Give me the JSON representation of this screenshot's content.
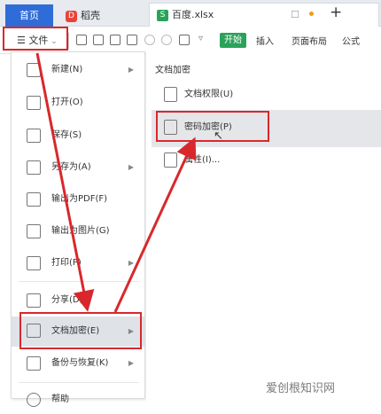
{
  "tabs": {
    "home": "首页",
    "daoke": "稻壳",
    "file": "百度.xlsx"
  },
  "toolbar": {
    "file_menu": "文件",
    "start": "开始",
    "insert": "插入",
    "page_layout": "页面布局",
    "formula": "公式"
  },
  "menu": {
    "items": [
      {
        "label": "新建(N)",
        "has_submenu": true
      },
      {
        "label": "打开(O)",
        "has_submenu": false
      },
      {
        "label": "保存(S)",
        "has_submenu": false
      },
      {
        "label": "另存为(A)",
        "has_submenu": true
      },
      {
        "label": "输出为PDF(F)",
        "has_submenu": false
      },
      {
        "label": "输出为图片(G)",
        "has_submenu": false
      },
      {
        "label": "打印(P)",
        "has_submenu": true
      },
      {
        "label": "分享(D)",
        "has_submenu": false
      },
      {
        "label": "文档加密(E)",
        "has_submenu": true,
        "active": true
      },
      {
        "label": "备份与恢复(K)",
        "has_submenu": true
      },
      {
        "label": "帮助",
        "has_submenu": true
      }
    ]
  },
  "submenu": {
    "title": "文档加密",
    "items": [
      {
        "label": "文档权限(U)"
      },
      {
        "label": "密码加密(P)",
        "active": true
      },
      {
        "label": "属性(I)..."
      }
    ]
  },
  "watermark": "爱创根知识网",
  "colors": {
    "highlight": "#d8282c",
    "start": "#2aa35a",
    "home_tab": "#2f6cd7"
  }
}
